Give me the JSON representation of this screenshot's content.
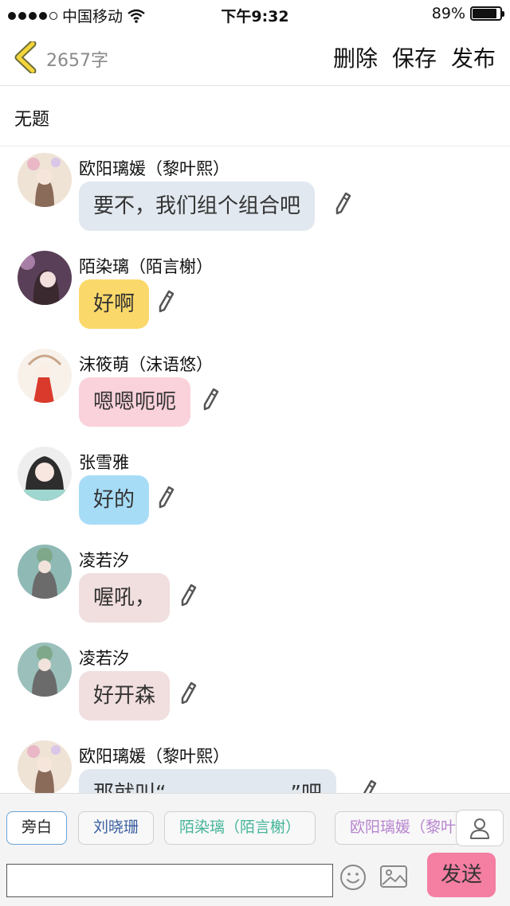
{
  "status": {
    "carrier": "中国移动",
    "time": "下午9:32",
    "battery": "89%",
    "battery_level": 0.89
  },
  "nav": {
    "word_count": "2657字",
    "actions": [
      "删除",
      "保存",
      "发布"
    ]
  },
  "title": "无题",
  "messages": [
    {
      "sender": "欧阳璃媛（黎叶熙）",
      "text": "要不，我们组个组合吧",
      "bubble_color": "#e1e8ef"
    },
    {
      "sender": "陌染璃（陌言榭）",
      "text": "好啊",
      "bubble_color": "#fbd86a"
    },
    {
      "sender": "沫筱萌（沫语悠）",
      "text": "嗯嗯呃呃",
      "bubble_color": "#fad2db"
    },
    {
      "sender": "张雪雅",
      "text": "好的",
      "bubble_color": "#a7dcf7"
    },
    {
      "sender": "凌若汐",
      "text": "喔吼，",
      "bubble_color": "#f1dede"
    },
    {
      "sender": "凌若汐",
      "text": "好开森",
      "bubble_color": "#f1dede"
    },
    {
      "sender": "欧阳璃媛（黎叶熙）",
      "text": "那就叫“　　　　　　”吧",
      "bubble_color": "#e1e8ef"
    }
  ],
  "roles": [
    {
      "label": "旁白",
      "color": "#222222"
    },
    {
      "label": "刘晓珊",
      "color": "#3a5fa0"
    },
    {
      "label": "陌染璃（陌言榭）",
      "color": "#45b59a"
    },
    {
      "label": "欧阳璃媛（黎叶熙）",
      "color": "#b784cf"
    }
  ],
  "input": {
    "value": "",
    "placeholder": ""
  },
  "send_label": "发送"
}
